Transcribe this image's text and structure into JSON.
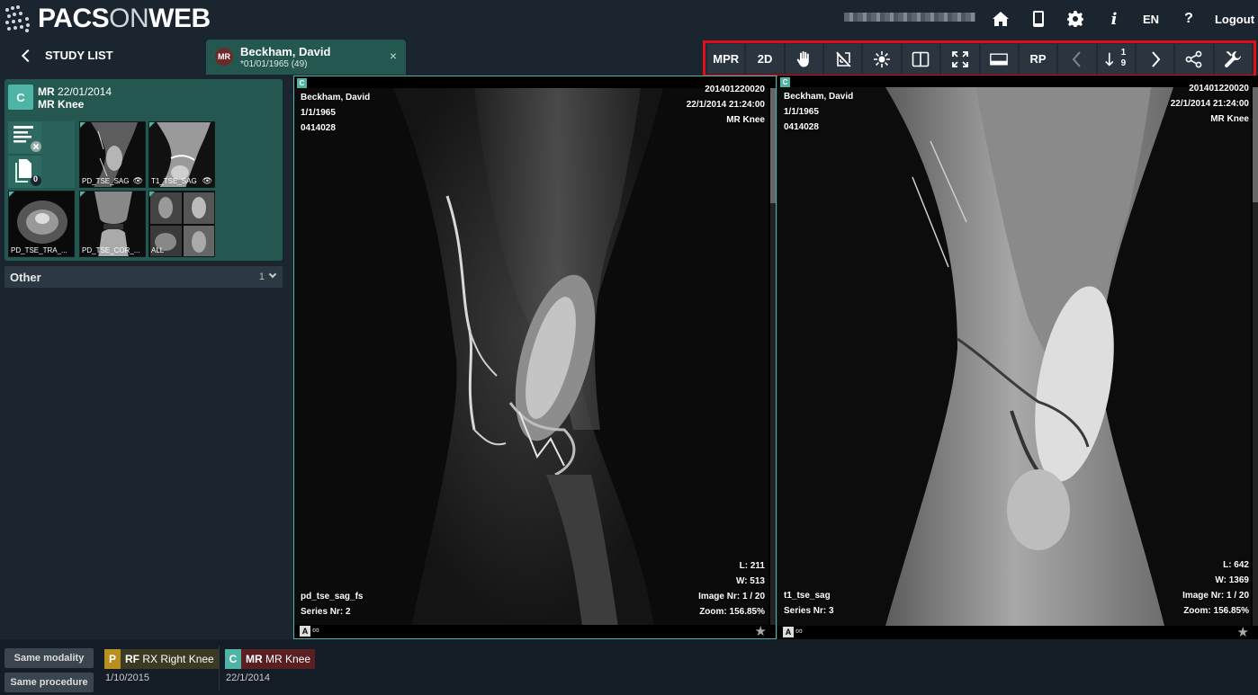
{
  "app": {
    "logo_main": "PACS",
    "logo_on": "ON",
    "logo_end": "WEB"
  },
  "topnav": {
    "home_icon": "home-icon",
    "mobile_icon": "mobile-phone-icon",
    "settings_icon": "gear-icon",
    "info_label": "i",
    "language": "EN",
    "help_label": "?",
    "logout": "Logout"
  },
  "nav": {
    "study_list": "STUDY LIST"
  },
  "patient_tab": {
    "avatar": "MR",
    "name": "Beckham, David",
    "dob": "*01/01/1965 (49)",
    "close": "×"
  },
  "toolbar": {
    "mpr": "MPR",
    "two_d": "2D",
    "rp": "RP",
    "sort_top": "1",
    "sort_bottom": "9",
    "icons": [
      "pan-hand-icon",
      "measure-ruler-icon",
      "brightness-contrast-icon",
      "layout-split-icon",
      "fullscreen-icon",
      "window-level-icon",
      "previous-icon",
      "sort-order-icon",
      "next-icon",
      "share-icon",
      "tools-icon"
    ]
  },
  "study": {
    "badge": "C",
    "modality": "MR",
    "date": "22/01/2014",
    "description": "MR Knee",
    "report_count": "0",
    "series": [
      {
        "label": "PD_TSE_SAG"
      },
      {
        "label": "T1_TSE_SAG"
      },
      {
        "label": "PD_TSE_TRA_..."
      },
      {
        "label": "PD_TSE_COR_..."
      },
      {
        "label": "ALL"
      }
    ]
  },
  "other_section": {
    "label": "Other",
    "count": "1"
  },
  "viewports": [
    {
      "badge": "C",
      "patient_name": "Beckham, David",
      "dob": "1/1/1965",
      "patient_id": "0414028",
      "accession": "201401220020",
      "datetime": "22/1/2014 21:24:00",
      "study_desc": "MR Knee",
      "level": "L: 211",
      "width": "W: 513",
      "series_desc": "pd_tse_sag_fs",
      "series_nr": "Series Nr: 2",
      "image_nr": "Image Nr: 1 / 20",
      "zoom": "Zoom: 156.85%",
      "anno": "A"
    },
    {
      "badge": "C",
      "patient_name": "Beckham, David",
      "dob": "1/1/1965",
      "patient_id": "0414028",
      "accession": "201401220020",
      "datetime": "22/1/2014 21:24:00",
      "study_desc": "MR Knee",
      "level": "L: 642",
      "width": "W: 1369",
      "series_desc": "t1_tse_sag",
      "series_nr": "Series Nr: 3",
      "image_nr": "Image Nr: 1 / 20",
      "zoom": "Zoom: 156.85%",
      "anno": "A"
    }
  ],
  "bottom": {
    "same_modality": "Same modality",
    "same_procedure": "Same procedure",
    "related": [
      {
        "badge": "P",
        "modality": "RF",
        "desc": "RX Right Knee",
        "date": "1/10/2015",
        "color": "#b8901f",
        "bg": "#3b3a22"
      },
      {
        "badge": "C",
        "modality": "MR",
        "desc": "MR Knee",
        "date": "22/1/2014",
        "color": "#4fb3a6",
        "bg": "#5a1f22"
      }
    ]
  },
  "colors": {
    "accent": "#4fb3a6",
    "tab_bg": "#23574f",
    "highlight_border": "#e0101a",
    "background": "#1a2530"
  }
}
